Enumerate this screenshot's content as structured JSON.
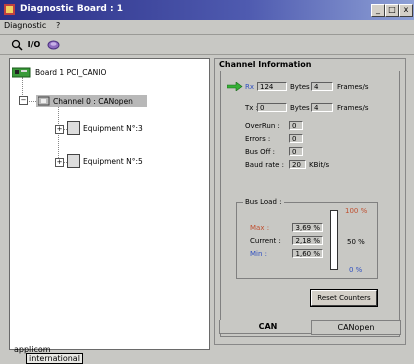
{
  "window": {
    "title": "Diagnostic Board : 1",
    "controls": [
      "_",
      "□",
      "x"
    ]
  },
  "menu": {
    "items": [
      "Diagnostic",
      "?"
    ]
  },
  "toolbar": {
    "buttons": [
      "search-icon",
      "I/O",
      "network-icon"
    ]
  },
  "tree": {
    "board": "Board 1 PCI_CANIO",
    "channel": "Channel 0 : CANopen",
    "equipment": [
      "Equipment N°:3",
      "Equipment N°:5"
    ]
  },
  "panel": {
    "title": "Channel Information",
    "rx": {
      "label": "Rx :",
      "bytes": "124",
      "bytes_unit": "Bytes",
      "frames": "4",
      "frames_unit": "Frames/s"
    },
    "tx": {
      "label": "Tx :",
      "bytes": "0",
      "bytes_unit": "Bytes",
      "frames": "4",
      "frames_unit": "Frames/s"
    },
    "overrun": {
      "label": "OverRun :",
      "value": "0"
    },
    "errors": {
      "label": "Errors :",
      "value": "0"
    },
    "busoff": {
      "label": "Bus Off :",
      "value": "0"
    },
    "baud": {
      "label": "Baud rate :",
      "value": "20",
      "unit": "KBit/s"
    },
    "busload": {
      "title": "Bus Load :",
      "max_label": "Max :",
      "max": "3,69 %",
      "current_label": "Current :",
      "current": "2,18 %",
      "min_label": "Min :",
      "min": "1,60 %",
      "scale_top": "100 %",
      "scale_mid": "50 %",
      "scale_bottom": "0 %",
      "max_color": "#c05030",
      "min_color": "#3050c0"
    },
    "reset": "Reset Counters",
    "tabs": [
      "CAN",
      "CANopen"
    ]
  },
  "footer": {
    "line1": "applicom",
    "line2": "international"
  }
}
